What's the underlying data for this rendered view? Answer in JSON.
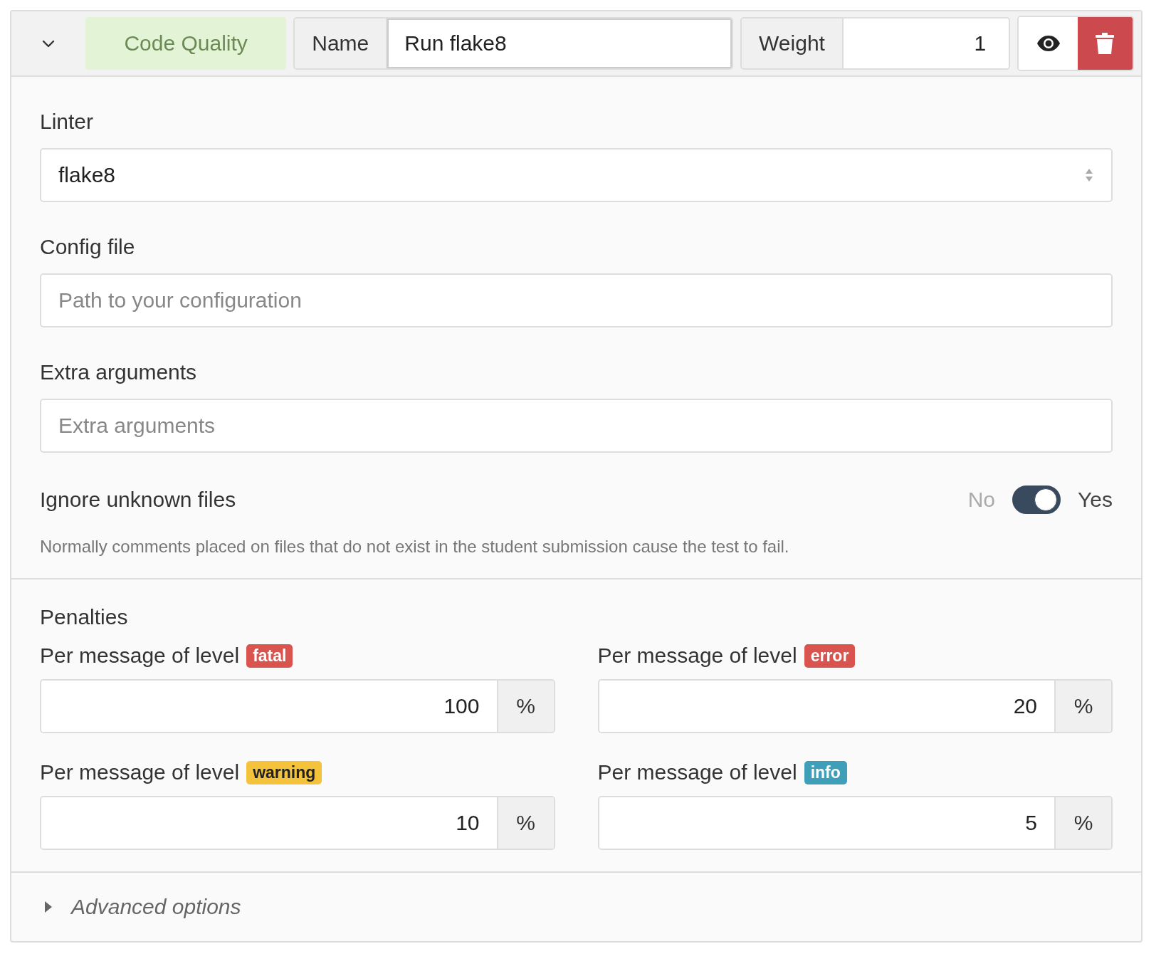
{
  "header": {
    "expanded": true,
    "category": "Code Quality",
    "name_label": "Name",
    "name_value": "Run flake8",
    "weight_label": "Weight",
    "weight_value": "1"
  },
  "linter": {
    "label": "Linter",
    "value": "flake8"
  },
  "config_file": {
    "label": "Config file",
    "placeholder": "Path to your configuration"
  },
  "extra_arguments": {
    "label": "Extra arguments",
    "placeholder": "Extra arguments"
  },
  "ignore_unknown": {
    "label": "Ignore unknown files",
    "off_label": "No",
    "on_label": "Yes",
    "on": true,
    "help": "Normally comments placed on files that do not exist in the student submission cause the test to fail."
  },
  "penalties": {
    "title": "Penalties",
    "items": [
      {
        "label": "Per message of level",
        "level": "fatal",
        "color": "#d9534f",
        "value": "100",
        "unit": "%"
      },
      {
        "label": "Per message of level",
        "level": "error",
        "color": "#d9534f",
        "value": "20",
        "unit": "%"
      },
      {
        "label": "Per message of level",
        "level": "warning",
        "color": "#f5c33b",
        "value": "10",
        "unit": "%"
      },
      {
        "label": "Per message of level",
        "level": "info",
        "color": "#3f9fb8",
        "value": "5",
        "unit": "%"
      }
    ]
  },
  "advanced": {
    "label": "Advanced options",
    "expanded": false
  }
}
